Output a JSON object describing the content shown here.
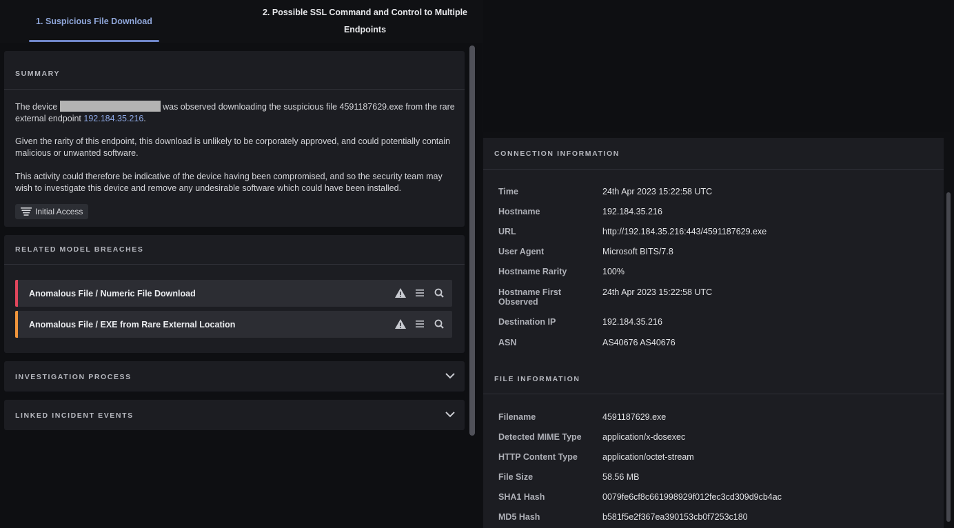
{
  "tabs": [
    {
      "label": "1. Suspicious File Download"
    },
    {
      "label": "2. Possible SSL Command and Control to Multiple Endpoints"
    }
  ],
  "summary": {
    "title": "SUMMARY",
    "p1_a": "The device ",
    "p1_b": " was observed downloading the suspicious file 4591187629.exe from the rare external endpoint ",
    "p1_link": "192.184.35.216",
    "p1_c": ".",
    "p2": "Given the rarity of this endpoint, this download is unlikely to be corporately approved, and could potentially contain malicious or unwanted software.",
    "p3": "This activity could therefore be indicative of the device having been compromised, and so the security team may wish to investigate this device and remove any undesirable software which could have been installed.",
    "tag": "Initial Access"
  },
  "related": {
    "title": "RELATED MODEL BREACHES",
    "items": [
      {
        "label": "Anomalous File / Numeric File Download",
        "color": "#e0465c"
      },
      {
        "label": "Anomalous File / EXE from Rare External Location",
        "color": "#f0953c"
      }
    ]
  },
  "investigation": {
    "title": "INVESTIGATION PROCESS"
  },
  "linked": {
    "title": "LINKED INCIDENT EVENTS"
  },
  "connection": {
    "title": "CONNECTION INFORMATION",
    "rows": [
      {
        "k": "Time",
        "v": "24th Apr 2023 15:22:58 UTC"
      },
      {
        "k": "Hostname",
        "v": "192.184.35.216"
      },
      {
        "k": "URL",
        "v": "http://192.184.35.216:443/4591187629.exe"
      },
      {
        "k": "User Agent",
        "v": "Microsoft BITS/7.8"
      },
      {
        "k": "Hostname Rarity",
        "v": "100%"
      },
      {
        "k": "Hostname First Observed",
        "v": "24th Apr 2023 15:22:58 UTC"
      },
      {
        "k": "Destination IP",
        "v": "192.184.35.216"
      },
      {
        "k": "ASN",
        "v": "AS40676 AS40676"
      }
    ]
  },
  "file": {
    "title": "FILE INFORMATION",
    "rows": [
      {
        "k": "Filename",
        "v": "4591187629.exe"
      },
      {
        "k": "Detected MIME Type",
        "v": "application/x-dosexec"
      },
      {
        "k": "HTTP Content Type",
        "v": "application/octet-stream"
      },
      {
        "k": "File Size",
        "v": "58.56 MB"
      },
      {
        "k": "SHA1 Hash",
        "v": "0079fe6cf8c661998929f012fec3cd309d9cb4ac"
      },
      {
        "k": "MD5 Hash",
        "v": "b581f5e2f367ea390153cb0f7253c180"
      }
    ]
  },
  "icons": {
    "next": "chevron-right-icon",
    "tag": "list-icon",
    "breach_actions": [
      "warning-icon",
      "menu-icon",
      "search-icon"
    ],
    "expand": "chevron-down-icon"
  }
}
